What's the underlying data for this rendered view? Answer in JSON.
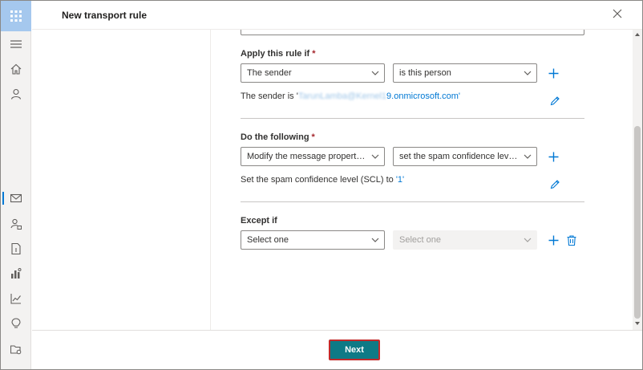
{
  "panel": {
    "title": "New transport rule"
  },
  "conditions": {
    "apply": {
      "label": "Apply this rule if",
      "required_mark": "*",
      "field1": "The sender",
      "field2": "is this person",
      "desc_prefix": "The sender is '",
      "desc_blurred": "TarunLamba@Kernel1",
      "desc_domain": "9.onmicrosoft.com",
      "desc_suffix": "'"
    },
    "action": {
      "label": "Do the following",
      "required_mark": "*",
      "field1": "Modify the message properties",
      "field2": "set the spam confidence level (SCL)",
      "desc_prefix": "Set the spam confidence level (SCL) to ",
      "desc_value": "'1'"
    },
    "exception": {
      "label": "Except if",
      "field1": "Select one",
      "field2": "Select one"
    }
  },
  "footer": {
    "next_label": "Next"
  },
  "colors": {
    "accent": "#0078d4",
    "next_button": "#0e7a86",
    "highlight_border": "#c22a2a",
    "required": "#a4262c"
  }
}
